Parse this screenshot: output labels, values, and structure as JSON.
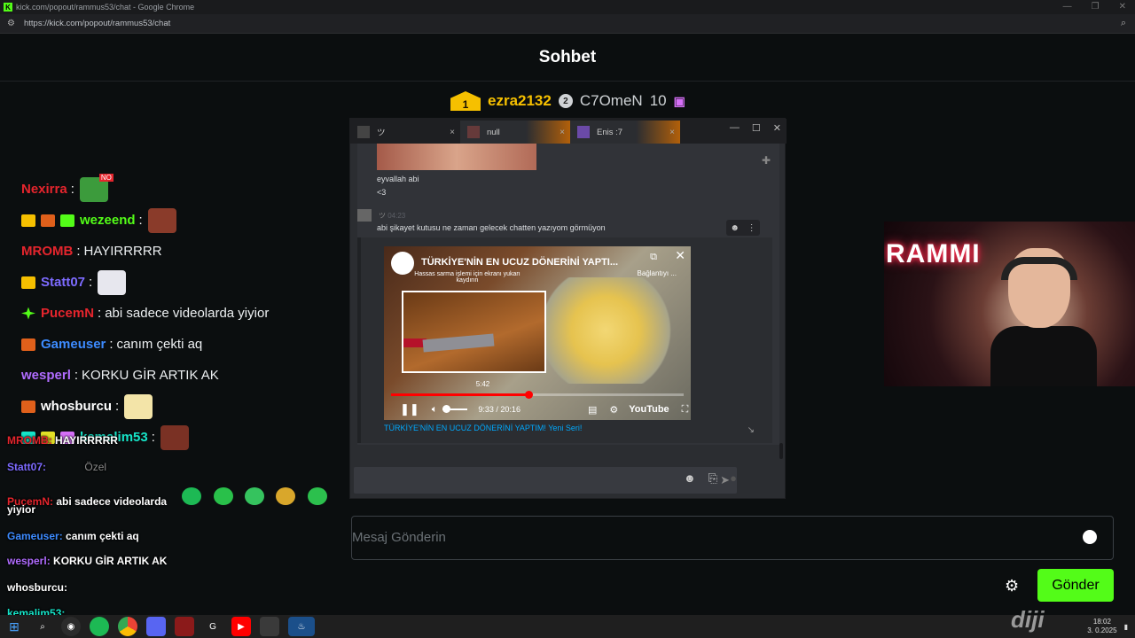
{
  "browser": {
    "title": "kick.com/popout/rammus53/chat - Google Chrome",
    "url": "https://kick.com/popout/rammus53/chat"
  },
  "chat": {
    "header": "Sohbet",
    "gifters": [
      {
        "rank": "1",
        "name": "ezra2132",
        "color": "#f6c000"
      },
      {
        "rank": "2",
        "name": "C7OmeN",
        "count": "10",
        "color": "#cfd3d6"
      }
    ],
    "messages": [
      {
        "user": "Nexirra",
        "sep": ":",
        "text": "",
        "color": "#e5252d",
        "emote_color": "#3c9b3c",
        "emote_tag": "NO"
      },
      {
        "user": "wezeend",
        "sep": ":",
        "text": "",
        "color": "#53fc18",
        "emote_color": "#8a3b2a"
      },
      {
        "user": "MROMB",
        "sep": ":",
        "text": "HAYIRRRRR",
        "color": "#e5252d"
      },
      {
        "user": "Statt07",
        "sep": ":",
        "text": "",
        "color": "#7d6bff",
        "emote_color": "#e7e7ee"
      },
      {
        "user": "PucemN",
        "sep": ":",
        "text": "abi sadece videolarda yiyior",
        "color": "#e5252d"
      },
      {
        "user": "Gameuser",
        "sep": ":",
        "text": "canım çekti aq",
        "color": "#3d8bff"
      },
      {
        "user": "wesperl",
        "sep": ":",
        "text": "KORKU GİR ARTIK AK",
        "color": "#b06cff"
      },
      {
        "user": "whosburcu",
        "sep": ":",
        "text": "",
        "color": "#ffffff",
        "emote_color": "#f3e4a8"
      },
      {
        "user": "kemalim53",
        "sep": ":",
        "text": "",
        "color": "#16e4c8",
        "emote_color": "#7a3124"
      }
    ],
    "input_placeholder": "Mesaj Gönderin",
    "send_label": "Gönder"
  },
  "overlay": {
    "lines": [
      {
        "user": "MROMB:",
        "text": "HAYIRRRRR",
        "color": "#e5252d"
      },
      {
        "user": "Statt07:",
        "text": "Özel",
        "color": "#7d6bff"
      },
      {
        "user": "PucemN:",
        "text": "abi sadece videolarda",
        "color": "#e5252d"
      },
      {
        "user": "",
        "text": "yiyior",
        "color": "#fff"
      },
      {
        "user": "Gameuser:",
        "text": "canım çekti aq",
        "color": "#3d8bff"
      },
      {
        "user": "wesperl:",
        "text": "KORKU GİR ARTIK AK",
        "color": "#b06cff"
      },
      {
        "user": "whosburcu:",
        "text": "",
        "color": "#ffffff"
      },
      {
        "user": "kemalim53:",
        "text": "",
        "color": "#16e4c8"
      }
    ]
  },
  "popup": {
    "tabs": [
      {
        "label": "ツ",
        "close": "×"
      },
      {
        "label": "null",
        "close": "×"
      },
      {
        "label": "Enis :7",
        "close": "×"
      }
    ],
    "controls": {
      "minimize": "—",
      "maximize": "☐",
      "close": "✕"
    },
    "messages": [
      {
        "text": "eyvallah abi"
      },
      {
        "text": "<3"
      }
    ],
    "author": {
      "name": "ツ",
      "time": "04:23"
    },
    "message3": "abi şikayet kutusu ne zaman gelecek chatten yazıyom görmüyon",
    "video": {
      "title": "TÜRKİYE'NİN EN UCUZ DÖNERİNİ YAPTI...",
      "subtitle": "Hassas sarma işlemi için ekranı yukarı kaydırın",
      "connect": "Bağlantıyı ...",
      "hover_time": "5:42",
      "time": "9:33 / 20:16",
      "progress": 0.47,
      "hover": 0.29,
      "platform": "YouTube",
      "embed_title": "TÜRKİYE'NİN EN UCUZ DÖNERİNİ YAPTIM! Yeni Seri!"
    }
  },
  "webcam": {
    "sign": "RAMMI"
  },
  "watermark": "diji",
  "taskbar": {
    "time": "18:02",
    "date": "3. 0.2025"
  }
}
